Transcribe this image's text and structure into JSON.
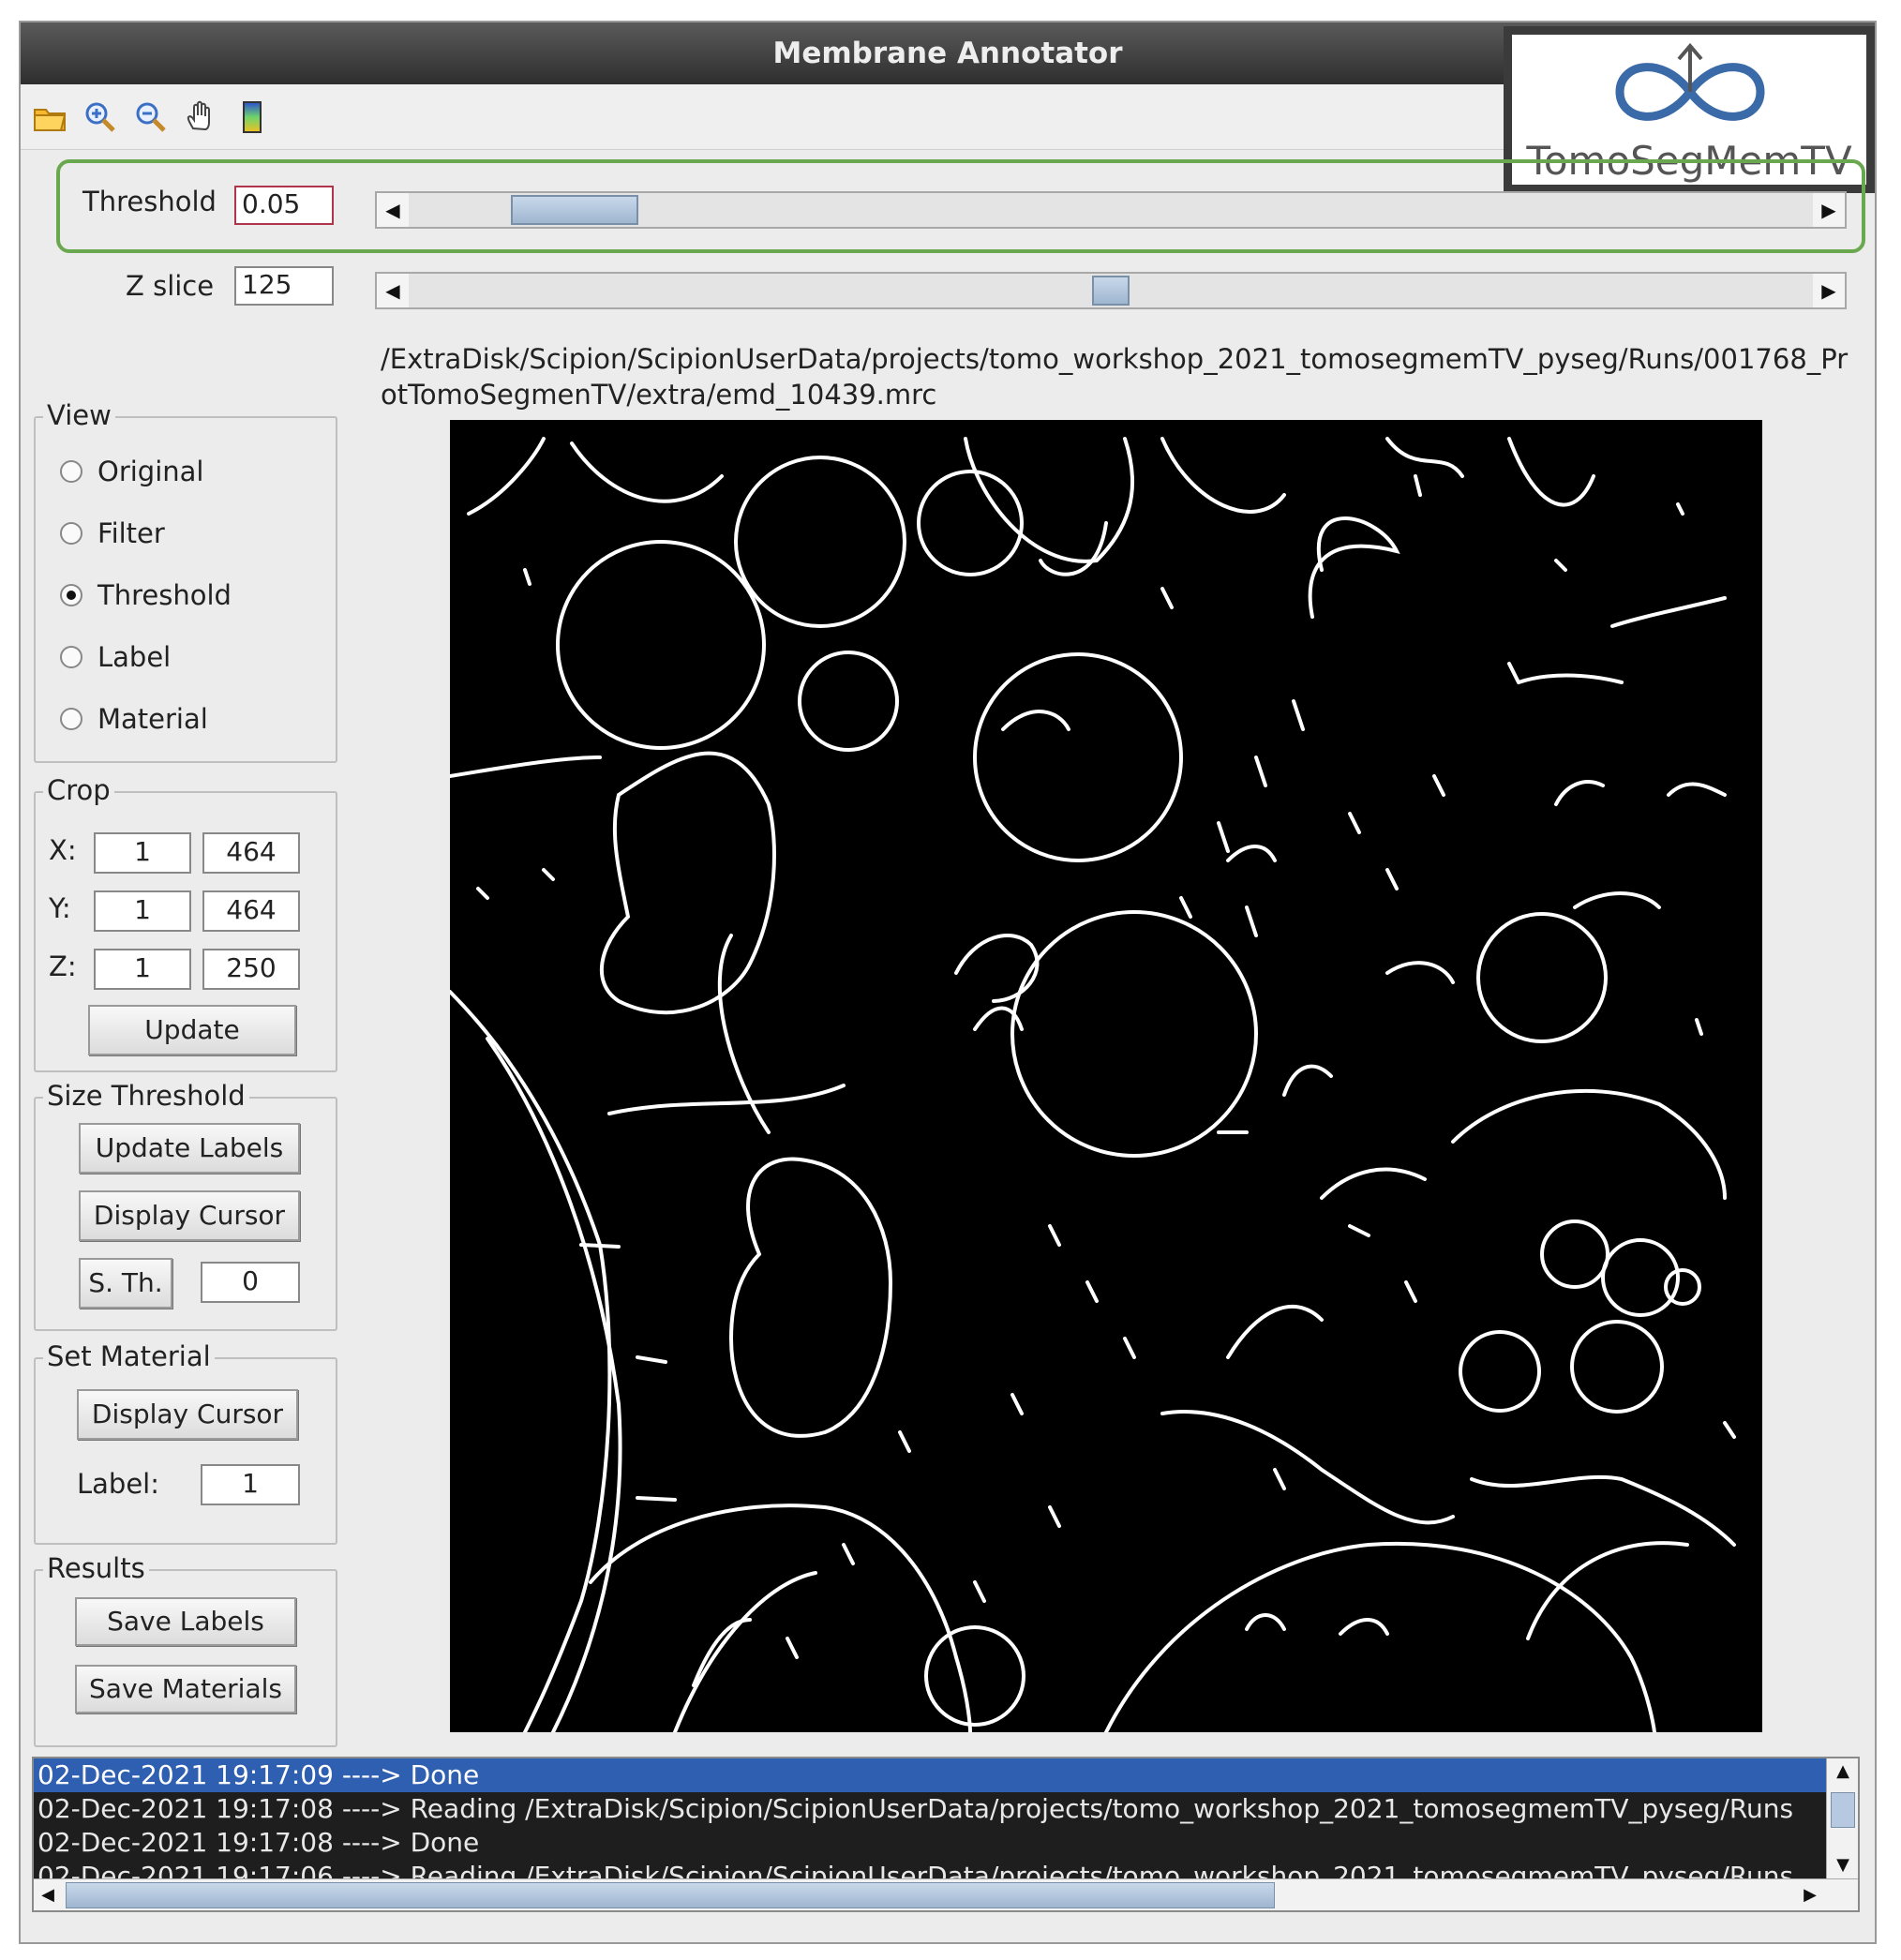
{
  "window": {
    "title": "Membrane Annotator"
  },
  "toolbar": {
    "icons": [
      "open-folder-icon",
      "zoom-in-icon",
      "zoom-out-icon",
      "pan-hand-icon",
      "colorbar-icon"
    ]
  },
  "logo": {
    "text": "TomoSegMemTV"
  },
  "threshold": {
    "label": "Threshold",
    "value": "0.05",
    "slider_fraction": 0.08
  },
  "zslice": {
    "label": "Z slice",
    "value": "125",
    "slider_fraction": 0.5
  },
  "file_path": "/ExtraDisk/Scipion/ScipionUserData/projects/tomo_workshop_2021_tomosegmemTV_pyseg/Runs/001768_ProtTomoSegmenTV/extra/emd_10439.mrc",
  "view": {
    "title": "View",
    "options": [
      "Original",
      "Filter",
      "Threshold",
      "Label",
      "Material"
    ],
    "selected": "Threshold"
  },
  "crop": {
    "title": "Crop",
    "x_label": "X:",
    "x_min": "1",
    "x_max": "464",
    "y_label": "Y:",
    "y_min": "1",
    "y_max": "464",
    "z_label": "Z:",
    "z_min": "1",
    "z_max": "250",
    "update_label": "Update"
  },
  "size_threshold": {
    "title": "Size Threshold",
    "update_labels": "Update Labels",
    "display_cursor": "Display Cursor",
    "sth_label": "S. Th.",
    "sth_value": "0"
  },
  "set_material": {
    "title": "Set Material",
    "display_cursor": "Display Cursor",
    "label_label": "Label:",
    "label_value": "1"
  },
  "results": {
    "title": "Results",
    "save_labels": "Save Labels",
    "save_materials": "Save Materials"
  },
  "log": [
    "02-Dec-2021 19:17:09 ----> Done",
    "02-Dec-2021 19:17:08 ----> Reading /ExtraDisk/Scipion/ScipionUserData/projects/tomo_workshop_2021_tomosegmemTV_pyseg/Runs",
    "02-Dec-2021 19:17:08 ----> Done",
    "02-Dec-2021 19:17:06 ----> Reading /ExtraDisk/Scipion/ScipionUserData/projects/tomo_workshop_2021_tomosegmemTV_pyseg/Runs"
  ],
  "colors": {
    "accent": "#6aa84f",
    "selection": "#2f5fb0",
    "titlebar": "#3a3a3a"
  }
}
